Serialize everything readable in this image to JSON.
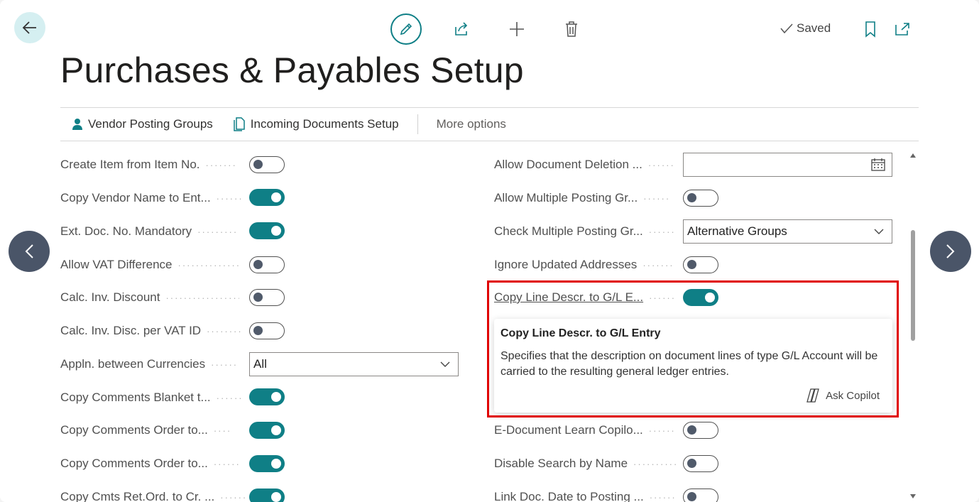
{
  "header": {
    "title": "Purchases & Payables Setup",
    "saved_label": "Saved"
  },
  "actions": {
    "vendor_posting_groups": "Vendor Posting Groups",
    "incoming_documents_setup": "Incoming Documents Setup",
    "more_options": "More options"
  },
  "left_fields": [
    {
      "label": "Create Item from Item No.",
      "type": "toggle",
      "value": false
    },
    {
      "label": "Copy Vendor Name to Ent...",
      "type": "toggle",
      "value": true
    },
    {
      "label": "Ext. Doc. No. Mandatory",
      "type": "toggle",
      "value": true
    },
    {
      "label": "Allow VAT Difference",
      "type": "toggle",
      "value": false
    },
    {
      "label": "Calc. Inv. Discount",
      "type": "toggle",
      "value": false
    },
    {
      "label": "Calc. Inv. Disc. per VAT ID",
      "type": "toggle",
      "value": false
    },
    {
      "label": "Appln. between Currencies",
      "type": "select",
      "value": "All"
    },
    {
      "label": "Copy Comments Blanket t...",
      "type": "toggle",
      "value": true
    },
    {
      "label": "Copy Comments Order to...",
      "type": "toggle",
      "value": true
    },
    {
      "label": "Copy Comments Order to...",
      "type": "toggle",
      "value": true
    },
    {
      "label": "Copy Cmts Ret.Ord. to Cr. ...",
      "type": "toggle",
      "value": true
    }
  ],
  "right_fields": [
    {
      "label": "Allow Document Deletion ...",
      "type": "date",
      "value": ""
    },
    {
      "label": "Allow Multiple Posting Gr...",
      "type": "toggle",
      "value": false
    },
    {
      "label": "Check Multiple Posting Gr...",
      "type": "select",
      "value": "Alternative Groups"
    },
    {
      "label": "Ignore Updated Addresses",
      "type": "toggle",
      "value": false
    },
    {
      "label": "Copy Line Descr. to G/L E...",
      "type": "toggle",
      "value": true
    },
    {
      "label": "E-Document Learn Copilo...",
      "type": "toggle",
      "value": false
    },
    {
      "label": "Disable Search by Name",
      "type": "toggle",
      "value": false
    },
    {
      "label": "Link Doc. Date to Posting ...",
      "type": "toggle",
      "value": false
    }
  ],
  "tooltip": {
    "title": "Copy Line Descr. to G/L Entry",
    "body": "Specifies that the description on document lines of type G/L Account will be carried to the resulting general ledger entries.",
    "copilot_label": "Ask Copilot"
  },
  "colors": {
    "accent": "#0f7f86",
    "highlight": "#e00000",
    "nav_button": "#4a5568"
  }
}
